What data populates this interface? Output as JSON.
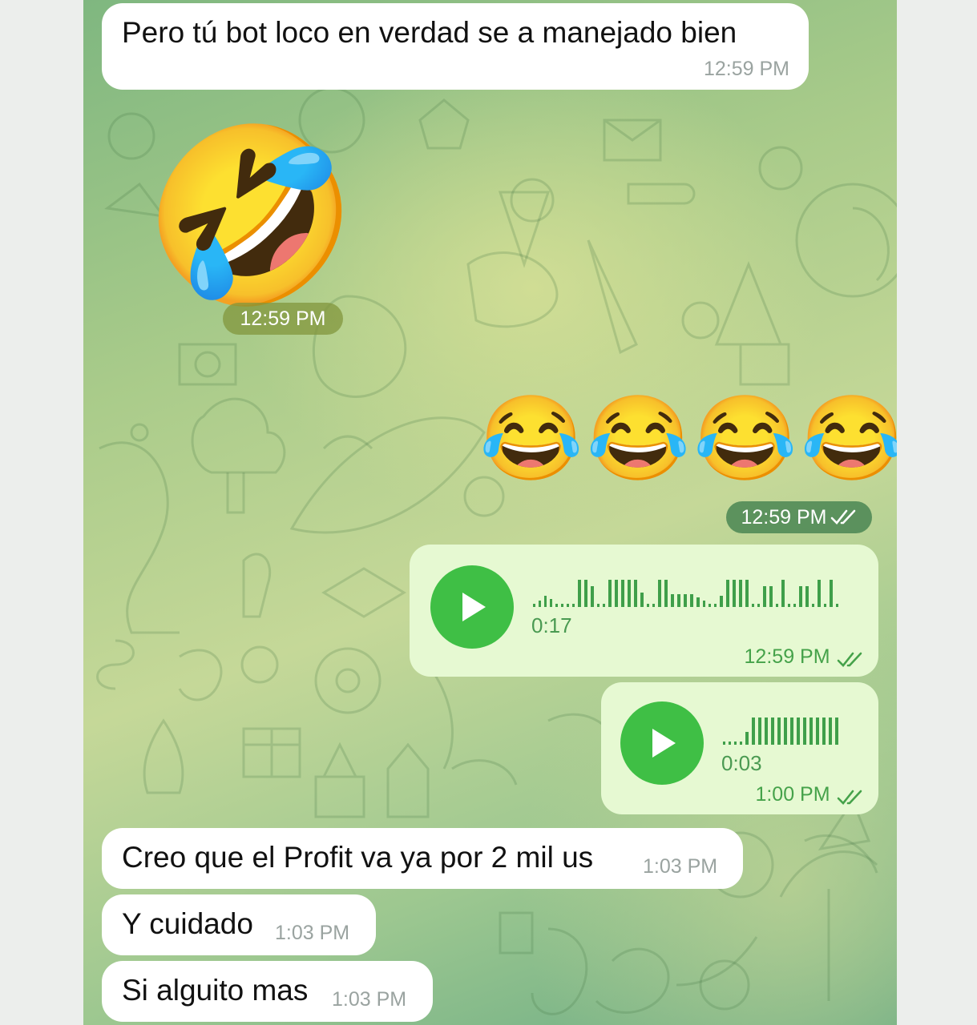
{
  "messages": {
    "m1": {
      "text": "Pero tú bot loco en verdad se a manejado bien",
      "time": "12:59 PM"
    },
    "m2": {
      "emoji": "🤣",
      "emoji_name": "rolling-on-floor-laughing",
      "time": "12:59 PM"
    },
    "m3": {
      "emoji": "😂😂😂😂",
      "emoji_name": "face-with-tears-of-joy",
      "time": "12:59 PM",
      "status": "read"
    },
    "m4": {
      "type": "voice",
      "duration": "0:17",
      "time": "12:59 PM",
      "status": "read"
    },
    "m5": {
      "type": "voice",
      "duration": "0:03",
      "time": "1:00 PM",
      "status": "read"
    },
    "m6": {
      "text": "Creo que el Profit va ya por 2 mil us",
      "time": "1:03 PM"
    },
    "m7": {
      "text": "Y cuidado",
      "time": "1:03 PM"
    },
    "m8": {
      "text": "Si alguito mas",
      "time": "1:03 PM"
    }
  },
  "icons": {
    "play": "play-icon",
    "read_receipt": "double-check-icon"
  },
  "colors": {
    "incoming_bubble": "#ffffff",
    "outgoing_bubble": "#e6f9d2",
    "accent_green": "#3fbf45",
    "time_outgoing": "#45a24a",
    "time_incoming": "#9aa3a0"
  }
}
